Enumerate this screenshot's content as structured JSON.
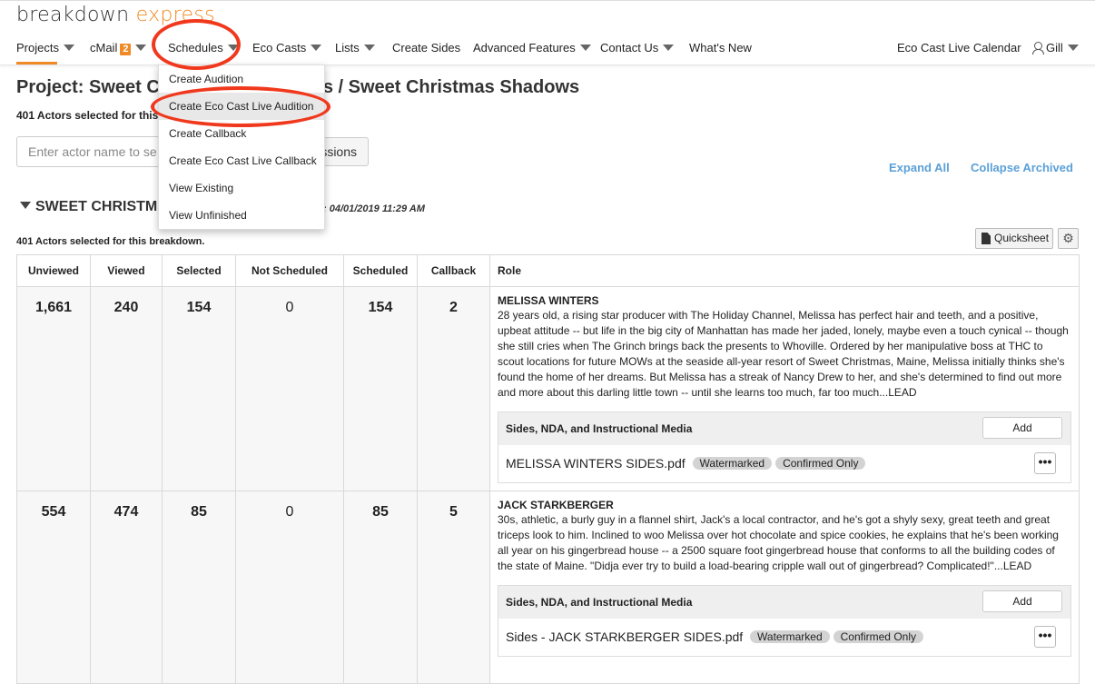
{
  "brand": {
    "name_main": "breakdown ",
    "name_accent": "express"
  },
  "nav": {
    "projects": "Projects",
    "cmail": "cMail",
    "cmail_badge": "2",
    "schedules": "Schedules",
    "eco_casts": "Eco Casts",
    "lists": "Lists",
    "create_sides": "Create Sides",
    "advanced_features": "Advanced Features",
    "contact_us": "Contact Us",
    "whats_new": "What's New",
    "eco_cast_live_calendar": "Eco Cast Live Calendar",
    "user": "Gill"
  },
  "schedules_menu": {
    "items": [
      "Create Audition",
      "Create Eco Cast Live Audition",
      "Create Callback",
      "Create Eco Cast Live Callback",
      "View Existing",
      "View Unfinished"
    ],
    "highlighted": "Create Eco Cast Live Audition"
  },
  "project": {
    "title_left": "Project: Sweet C",
    "title_right": "s / Sweet Christmas Shadows",
    "actors_selected_left": "401 Actors selected for this",
    "search_placeholder": "Enter actor name to se",
    "sessions_button_text": "ssions",
    "expand_all": "Expand All",
    "collapse_archived": "Collapse Archived"
  },
  "breakdown": {
    "heading": "SWEET CHRISTM",
    "date_fragment": ": 04/01/2019 11:29 AM",
    "actors_selected": "401 Actors selected for this breakdown.",
    "quicksheet": "Quicksheet",
    "gear_icon": "⚙"
  },
  "table": {
    "headers": [
      "Unviewed",
      "Viewed",
      "Selected",
      "Not Scheduled",
      "Scheduled",
      "Callback",
      "Role"
    ],
    "rows": [
      {
        "unviewed": "1,661",
        "viewed": "240",
        "selected": "154",
        "not_scheduled": "0",
        "scheduled": "154",
        "callback": "2",
        "role_name": "MELISSA WINTERS",
        "role_desc": "28 years old, a rising star producer with The Holiday Channel, Melissa has perfect hair and teeth, and a positive, upbeat attitude -- but life in the big city of Manhattan has made her jaded, lonely, maybe even a touch cynical -- though she still cries when The Grinch brings back the presents to Whoville.  Ordered by her manipulative boss at THC to scout locations for future MOWs at the seaside all-year resort of Sweet Christmas, Maine, Melissa initially thinks she's found the home of her dreams.  But Melissa has a streak of Nancy Drew to her, and she's determined to find out more and more about this darling little town -- until she learns too much, far too much...LEAD",
        "media_title": "Sides, NDA, and Instructional Media",
        "add_label": "Add",
        "file_name": "MELISSA WINTERS SIDES.pdf",
        "tag1": "Watermarked",
        "tag2": "Confirmed Only"
      },
      {
        "unviewed": "554",
        "viewed": "474",
        "selected": "85",
        "not_scheduled": "0",
        "scheduled": "85",
        "callback": "5",
        "role_name": "JACK STARKBERGER",
        "role_desc": "30s, athletic, a burly guy in a flannel shirt, Jack's a local contractor, and he's got a shyly sexy, great teeth and great triceps look to him.  Inclined to woo Melissa over hot chocolate and spice cookies, he explains that he's been working all year on his gingerbread house -- a 2500 square foot gingerbread house that conforms to all the building codes of the state of Maine.  \"Didja ever try to build a load-bearing cripple wall out of gingerbread? Complicated!\"...LEAD",
        "media_title": "Sides, NDA, and Instructional Media",
        "add_label": "Add",
        "file_name": "Sides - JACK STARKBERGER SIDES.pdf",
        "tag1": "Watermarked",
        "tag2": "Confirmed Only"
      }
    ]
  },
  "colors": {
    "accent": "#f08a24",
    "link": "#5aa0d8",
    "annotation": "#f0381d"
  }
}
